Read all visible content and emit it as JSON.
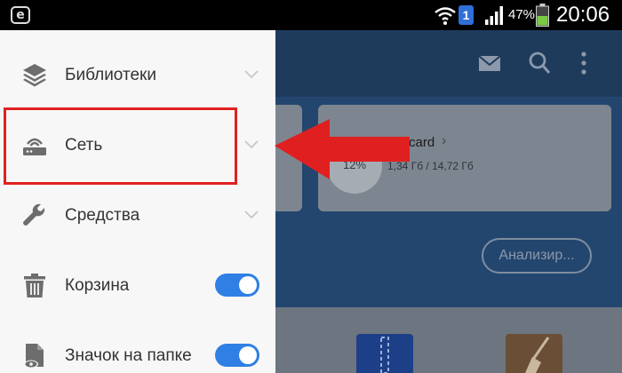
{
  "statusbar": {
    "app_icon_letter": "e",
    "notification_badge": "1",
    "battery_percent": "47%",
    "time": "20:06",
    "icons": [
      "wifi-icon",
      "signal-icon",
      "battery-icon"
    ]
  },
  "drawer": {
    "items": [
      {
        "label": "Библиотеки",
        "icon": "layers-icon",
        "control": "chevron"
      },
      {
        "label": "Сеть",
        "icon": "router-icon",
        "control": "chevron"
      },
      {
        "label": "Средства",
        "icon": "wrench-icon",
        "control": "chevron"
      },
      {
        "label": "Корзина",
        "icon": "trash-icon",
        "control": "toggle",
        "toggle_on": true
      },
      {
        "label": "Значок на папке",
        "icon": "file-eye-icon",
        "control": "toggle",
        "toggle_on": true
      }
    ]
  },
  "background_app": {
    "toolbar_icons": [
      "mail-icon",
      "search-icon",
      "more-vert-icon"
    ],
    "card_title": "card",
    "card_size": "1,34 Гб / 14,72 Гб",
    "card_percent": "12%",
    "analyze_button": "Анализир..."
  },
  "colors": {
    "drawer_bg": "#f7f7f7",
    "toggle_on": "#2f7fe4",
    "annotation_red": "#e02020",
    "app_dim_bg": "#23466f"
  }
}
